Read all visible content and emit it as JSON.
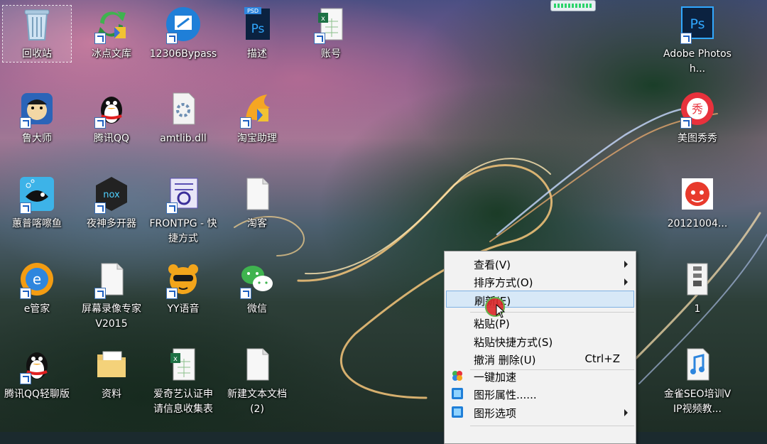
{
  "desktop": {
    "icons": [
      {
        "label": "回收站"
      },
      {
        "label": "冰点文库"
      },
      {
        "label": "12306Bypass"
      },
      {
        "label": "描述"
      },
      {
        "label": "账号"
      },
      {
        "label": "Adobe Photosh..."
      },
      {
        "label": "鲁大师"
      },
      {
        "label": "腾讯QQ"
      },
      {
        "label": "amtlib.dll"
      },
      {
        "label": "淘宝助理"
      },
      {
        "label": "美图秀秀"
      },
      {
        "label": "蕙普喀嚓鱼"
      },
      {
        "label": "夜神多开器"
      },
      {
        "label": "FRONTPG - 快捷方式"
      },
      {
        "label": "淘客"
      },
      {
        "label": "20121004..."
      },
      {
        "label": "e管家"
      },
      {
        "label": "屏幕录像专家 V2015"
      },
      {
        "label": "YY语音"
      },
      {
        "label": "微信"
      },
      {
        "label": "1"
      },
      {
        "label": "腾讯QQ轻聊版"
      },
      {
        "label": "资料"
      },
      {
        "label": "爱奇艺认证申请信息收集表"
      },
      {
        "label": "新建文本文档 (2)"
      },
      {
        "label": "金雀SEO培训VIP视频教..."
      }
    ],
    "icon_badges": {
      "psd": "PSD",
      "ps": "Ps",
      "nox": "nox"
    }
  },
  "context_menu": {
    "items": [
      {
        "label": "查看(V)",
        "shortcut": ""
      },
      {
        "label": "排序方式(O)",
        "shortcut": ""
      },
      {
        "label": "刷新(E)",
        "shortcut": ""
      },
      {
        "label": "粘贴(P)",
        "shortcut": ""
      },
      {
        "label": "粘贴快捷方式(S)",
        "shortcut": ""
      },
      {
        "label": "撤消 删除(U)",
        "shortcut": "Ctrl+Z"
      },
      {
        "label": "一键加速",
        "shortcut": ""
      },
      {
        "label": "图形属性......",
        "shortcut": ""
      },
      {
        "label": "图形选项",
        "shortcut": ""
      }
    ]
  },
  "colors": {
    "menu_highlight": "#d7e8f7",
    "menu_highlight_border": "#7fb1e4",
    "progress_green": "#2bd46a"
  }
}
